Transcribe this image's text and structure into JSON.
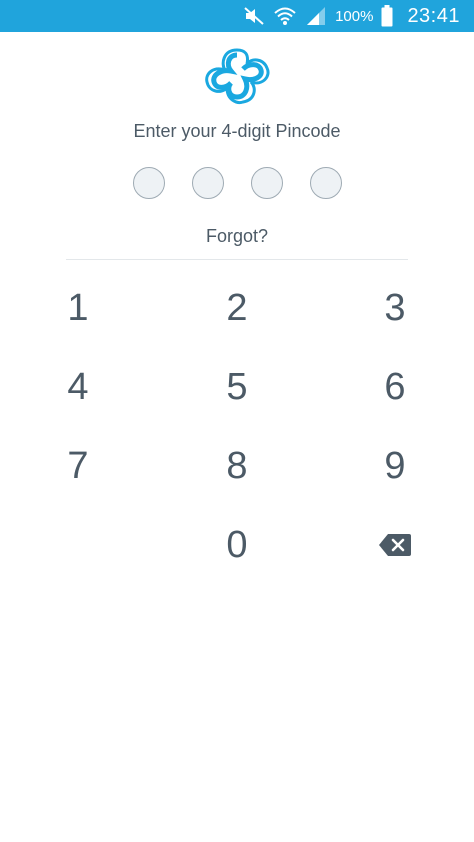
{
  "status_bar": {
    "battery_percent": "100%",
    "time": "23:41",
    "icons": [
      "mute-icon",
      "wifi-icon",
      "signal-icon",
      "battery-icon"
    ],
    "background": "#20a4dc"
  },
  "logo": {
    "icon": "sync-cloud-logo",
    "color": "#1aa8e0"
  },
  "prompt": "Enter your 4-digit Pincode",
  "pin": {
    "length": 4,
    "entered": 0
  },
  "forgot_label": "Forgot?",
  "keypad": {
    "keys": [
      "1",
      "2",
      "3",
      "4",
      "5",
      "6",
      "7",
      "8",
      "9",
      "0"
    ],
    "backspace_icon": "backspace-icon"
  },
  "colors": {
    "text": "#4c5a66",
    "accent": "#20a4dc",
    "dot_fill": "#eef2f5",
    "dot_border": "#9eaab3"
  }
}
